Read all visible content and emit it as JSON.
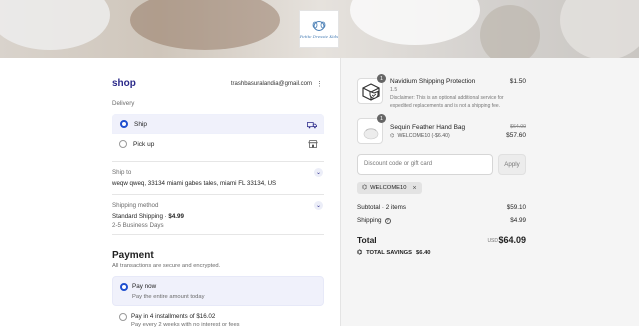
{
  "brand": {
    "logo_text": "Petite Dressie Kids"
  },
  "header": {
    "shop_name": "shop",
    "email": "trashbasuralandia@gmail.com",
    "menu_icon": "kebab-icon"
  },
  "delivery": {
    "label": "Delivery",
    "options": [
      {
        "label": "Ship",
        "selected": true,
        "icon": "truck-icon"
      },
      {
        "label": "Pick up",
        "selected": false,
        "icon": "store-icon"
      }
    ]
  },
  "ship_to": {
    "label": "Ship to",
    "address": "weqw qweq, 33134 miami gabes tales, miami FL 33134, US"
  },
  "shipping_method": {
    "label": "Shipping method",
    "name": "Standard Shipping · ",
    "price": "$4.99",
    "eta": "2-5 Business Days"
  },
  "payment": {
    "title": "Payment",
    "subtitle": "All transactions are secure and encrypted.",
    "options": [
      {
        "label": "Pay now",
        "detail": "Pay the entire amount today",
        "selected": true
      },
      {
        "label": "Pay in 4 installments of $16.02",
        "detail": "Pay every 2 weeks with no interest or fees",
        "selected": false
      }
    ]
  },
  "cart": {
    "items": [
      {
        "qty": "1",
        "name": "Navidium Shipping Protection",
        "variant": "1.5",
        "disclaimer": "Disclaimer: This is an optional additional service for expedited replacements and is not a shipping fee.",
        "price": "$1.50"
      },
      {
        "qty": "1",
        "name": "Sequin Feather Hand Bag",
        "discount_code": "WELCOME10 (-$6.40)",
        "original_price": "$64.00",
        "price": "$57.60"
      }
    ],
    "discount_placeholder": "Discount code or gift card",
    "apply_label": "Apply",
    "applied_code": "WELCOME10"
  },
  "summary": {
    "subtotal_label": "Subtotal · 2 items",
    "subtotal_value": "$59.10",
    "shipping_label": "Shipping",
    "shipping_value": "$4.99",
    "total_label": "Total",
    "currency": "USD",
    "total_value": "$64.09",
    "savings_label": "TOTAL SAVINGS",
    "savings_value": "$6.40"
  },
  "colors": {
    "accent": "#1f4fcf",
    "brand": "#2b2a8a",
    "selected_bg": "#f0f1fb"
  }
}
